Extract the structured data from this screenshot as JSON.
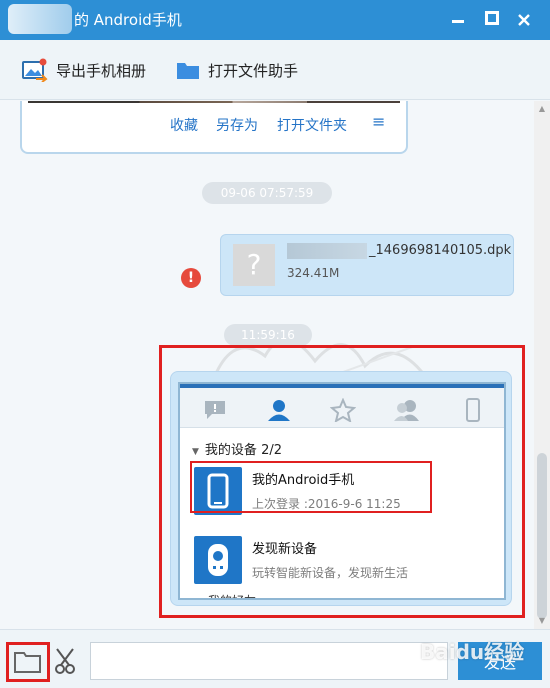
{
  "window": {
    "title": "的 Android手机",
    "minimize_glyph": "▬",
    "maximize_glyph": "◼",
    "close_glyph": "✕"
  },
  "toolbar": {
    "export_label": "导出手机相册",
    "open_assistant_label": "打开文件助手"
  },
  "chat": {
    "top_card_actions": {
      "collect": "收藏",
      "save_as": "另存为",
      "open_folder": "打开文件夹",
      "menu_glyph": "≡"
    },
    "timestamps": [
      "09-06 07:57:59",
      "11:59:16"
    ],
    "file_message": {
      "icon_glyph": "?",
      "filename_suffix": "_1469698140105.dpk",
      "size": "324.41M",
      "status": "warning"
    },
    "screenshot_message": {
      "section_title": "我的设备",
      "section_count": "2/2",
      "devices": [
        {
          "name": "我的Android手机",
          "subtitle": "上次登录 :2016-9-6 11:25"
        },
        {
          "name": "发现新设备",
          "subtitle": "玩转智能新设备，发现新生活"
        }
      ],
      "more_label": "我的好友"
    }
  },
  "input_bar": {
    "placeholder": "",
    "send_label": "发送"
  },
  "watermark": "Baidu经验",
  "colors": {
    "accent": "#2d8fd5",
    "bubble": "#cde6f8",
    "highlight": "#e02020",
    "link": "#2574c7"
  }
}
